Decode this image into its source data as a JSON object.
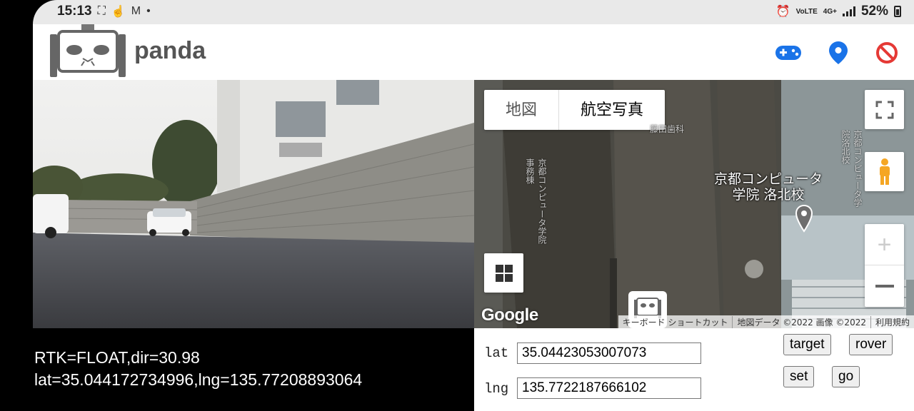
{
  "status_bar": {
    "time": "15:13",
    "left_icons": [
      "screen-record-icon",
      "hand-icon",
      "gmail-icon",
      "dot-icon"
    ],
    "volte_label": "VoLTE",
    "network_label": "4G+",
    "battery_percent": "52%"
  },
  "header": {
    "app_name": "panda"
  },
  "telemetry": {
    "line1": "RTK=FLOAT,dir=30.98",
    "line2": "lat=35.044172734996,lng=135.77208893064"
  },
  "map": {
    "type_tabs": [
      "地図",
      "航空写真"
    ],
    "active_tab": "航空写真",
    "labels": {
      "main_poi": "京都コンピュータ\n学院 洛北校",
      "dentist": "藤田歯科",
      "office": "京都コンピュータ学院事務棟",
      "school_right": "京都コンピュータ学院洛北校"
    },
    "google_logo": "Google",
    "attribution": [
      "キーボード ショートカット",
      "地図データ ©2022 画像 ©2022",
      "利用規約"
    ]
  },
  "control": {
    "lat_label": "lat",
    "lng_label": "lng",
    "lat_value": "35.04423053007073",
    "lng_value": "135.7722187666102",
    "target_button": "target",
    "rover_button": "rover",
    "set_button": "set",
    "go_button": "go"
  },
  "colors": {
    "accent_blue": "#1a73e8",
    "stop_red": "#e53935"
  }
}
